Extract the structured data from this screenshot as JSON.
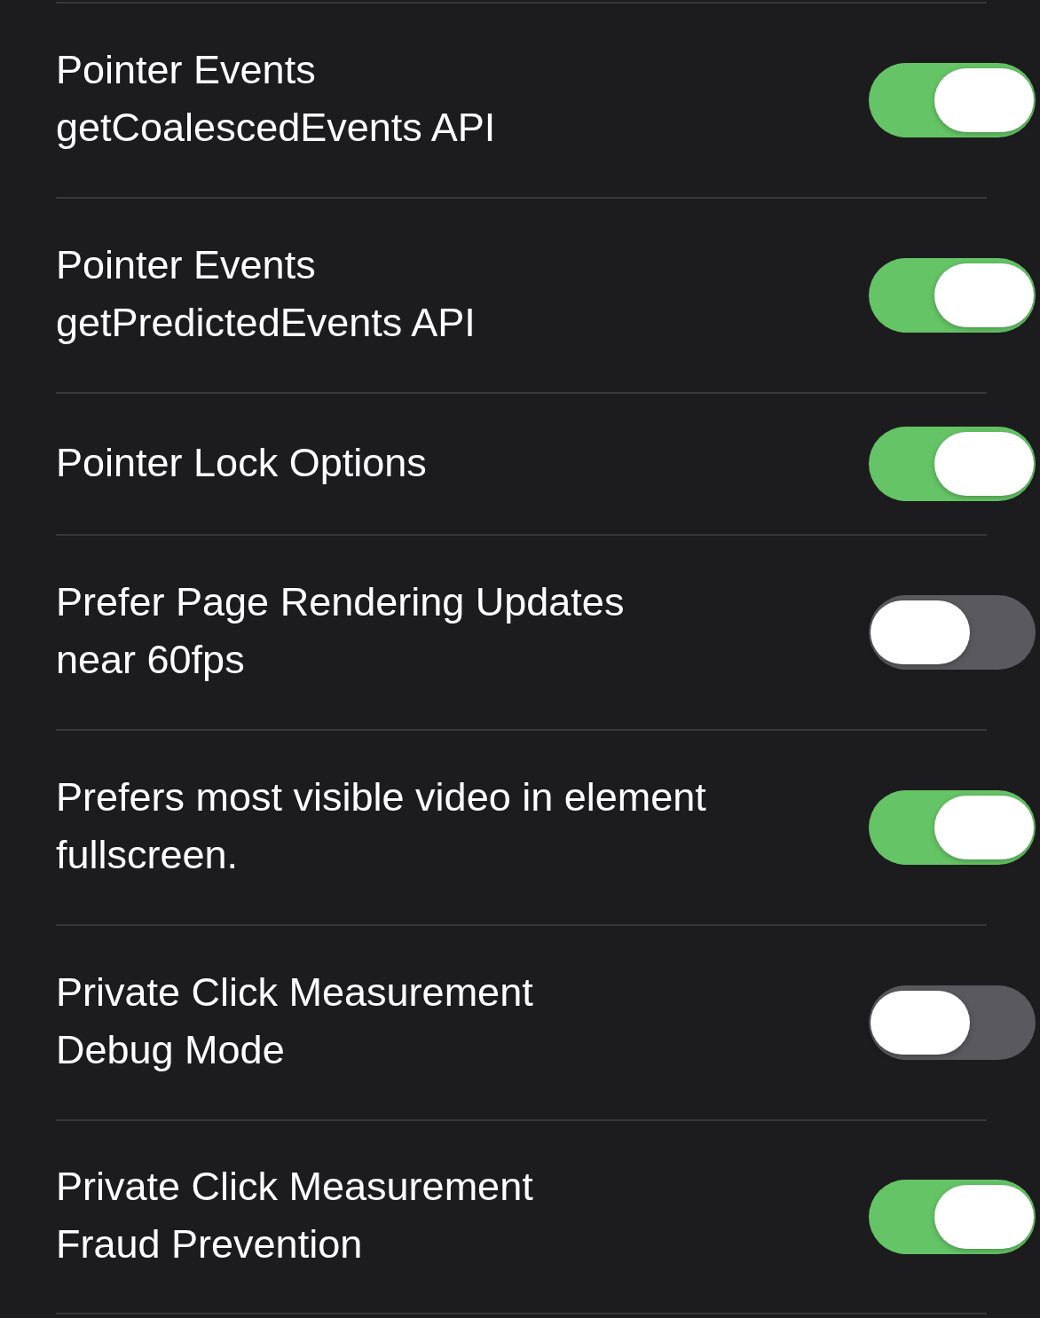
{
  "settings": [
    {
      "label": "Pointer Events\ngetCoalescedEvents API",
      "on": true
    },
    {
      "label": "Pointer Events\ngetPredictedEvents API",
      "on": true
    },
    {
      "label": "Pointer Lock Options",
      "on": true
    },
    {
      "label": "Prefer Page Rendering Updates\nnear 60fps",
      "on": false
    },
    {
      "label": "Prefers most visible video in element\nfullscreen.",
      "on": true
    },
    {
      "label": "Private Click Measurement\nDebug Mode",
      "on": false
    },
    {
      "label": "Private Click Measurement\nFraud Prevention",
      "on": true
    }
  ]
}
